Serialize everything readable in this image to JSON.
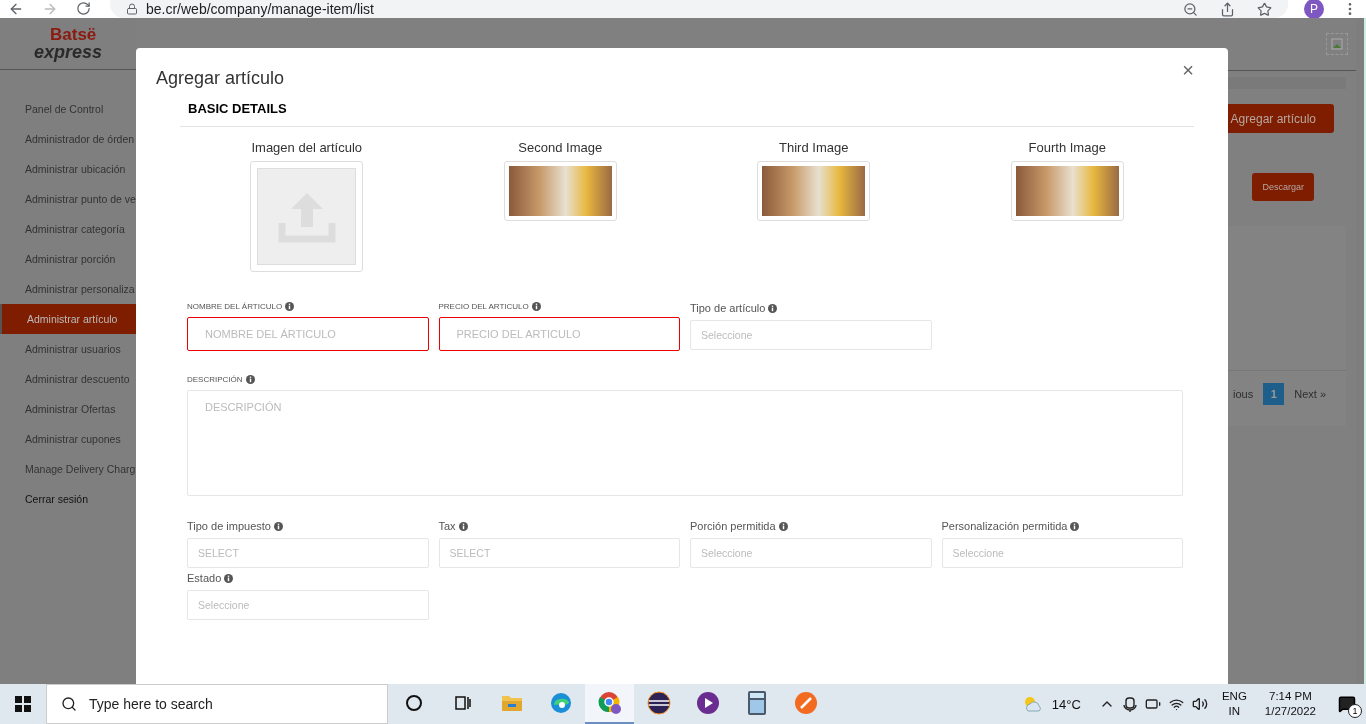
{
  "browser": {
    "url": "be.cr/web/company/manage-item/list",
    "profile_initial": "P"
  },
  "logo": {
    "top": "Batsë",
    "bottom": "express"
  },
  "sidebar": {
    "items": [
      {
        "label": "Panel de Control",
        "selected": false,
        "kind": "link"
      },
      {
        "label": "Administrador de órden",
        "selected": false,
        "kind": "link"
      },
      {
        "label": "Administrar ubicación",
        "selected": false,
        "kind": "link"
      },
      {
        "label": "Administrar punto de ve",
        "selected": false,
        "kind": "link"
      },
      {
        "label": "Administrar categoría",
        "selected": false,
        "kind": "link"
      },
      {
        "label": "Administrar porción",
        "selected": false,
        "kind": "link"
      },
      {
        "label": "Administrar personaliza",
        "selected": false,
        "kind": "link"
      },
      {
        "label": "Administrar artículo",
        "selected": true,
        "kind": "link"
      },
      {
        "label": "Administrar usuarios",
        "selected": false,
        "kind": "link"
      },
      {
        "label": "Administrar descuento",
        "selected": false,
        "kind": "link"
      },
      {
        "label": "Administrar Ofertas",
        "selected": false,
        "kind": "link"
      },
      {
        "label": "Administrar cupones",
        "selected": false,
        "kind": "link"
      },
      {
        "label": "Manage Delivery Charg",
        "selected": false,
        "kind": "link"
      },
      {
        "label": "Cerrar sesión",
        "selected": false,
        "kind": "logout"
      }
    ]
  },
  "page": {
    "add_button": "Agregar artículo",
    "download_button": "Descargar",
    "pagination": {
      "previous": "ious",
      "pages": [
        {
          "label": "1",
          "selected": true
        }
      ],
      "next": "Next",
      "next_icon": "»"
    }
  },
  "modal": {
    "title": "Agregar artículo",
    "close": "×",
    "section": "BASIC DETAILS",
    "images": [
      {
        "label": "Imagen del artículo",
        "kind": "upload"
      },
      {
        "label": "Second Image",
        "kind": "photo"
      },
      {
        "label": "Third Image",
        "kind": "photo"
      },
      {
        "label": "Fourth Image",
        "kind": "photo"
      }
    ],
    "fields": [
      {
        "label": "NOMBRE DEL ÁRTICULO",
        "placeholder": "NOMBRE DEL ÁRTICULO",
        "kind": "input",
        "invalid": true
      },
      {
        "label": "PRECIO DEL ARTICULO",
        "placeholder": "PRECIO DEL ARTICULO",
        "kind": "input",
        "invalid": true
      },
      {
        "label": "Tipo de artículo",
        "placeholder": "Seleccione",
        "kind": "select",
        "invalid": false
      },
      {
        "label": "DESCRIPCIÓN",
        "placeholder": "DESCRIPCIÓN",
        "kind": "textarea",
        "invalid": false
      },
      {
        "label": "Tipo de impuesto",
        "placeholder": "SELECT",
        "kind": "select",
        "invalid": false
      },
      {
        "label": "Tax",
        "placeholder": "SELECT",
        "kind": "select",
        "invalid": false
      },
      {
        "label": "Porción permitida",
        "placeholder": "Seleccione",
        "kind": "select",
        "invalid": false
      },
      {
        "label": "Personalización permitida",
        "placeholder": "Seleccione",
        "kind": "select",
        "invalid": false
      },
      {
        "label": "Estado",
        "placeholder": "Seleccione",
        "kind": "select",
        "invalid": false
      }
    ]
  },
  "taskbar": {
    "search_placeholder": "Type here to search",
    "apps": [
      {
        "kind": "cortana",
        "selected": false
      },
      {
        "kind": "taskview",
        "selected": false
      },
      {
        "kind": "folder",
        "selected": false
      },
      {
        "kind": "edge",
        "selected": false
      },
      {
        "kind": "chrome",
        "selected": true
      },
      {
        "kind": "eclipse",
        "selected": false
      },
      {
        "kind": "purple",
        "selected": false
      },
      {
        "kind": "calculator",
        "selected": false
      },
      {
        "kind": "pencil",
        "selected": false
      }
    ],
    "weather": "14°C",
    "language": "ENG",
    "region": "IN",
    "time": "7:14 PM",
    "date": "1/27/2022",
    "notifications": "1"
  }
}
